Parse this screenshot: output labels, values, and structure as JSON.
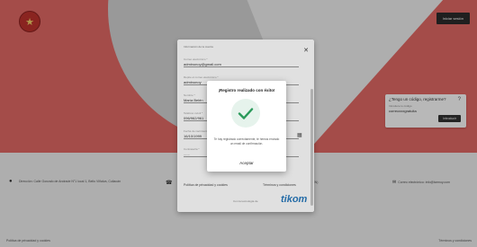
{
  "header": {
    "top_button": "Iniciar sesión"
  },
  "code_card": {
    "title": "¿Tengo un código, registrarme?",
    "input_label": "Introduce tu código",
    "input_value": "correoxxxgratuita",
    "button": "Introducir"
  },
  "footer": {
    "address": "Dirección: Calle Gonzalo de Andrade N°1 local 1, Bello Viñalva, Culiacán",
    "phone_ext": "PEN)",
    "email": "Correo electrónico: info@tarmoy.com",
    "bottom_left": "Política de privacidad y cookies",
    "bottom_right": "Términos y condiciones"
  },
  "registration": {
    "header": "Información de la cuenta",
    "fields": [
      {
        "label": "Correo electrónico *",
        "value": "adminunoy@gmail.com"
      },
      {
        "label": "Repite el correo electrónico *",
        "value": "adminunoy"
      },
      {
        "label": "Nombre *",
        "value": "María Belén"
      },
      {
        "label": "Teléfono móvil *",
        "value": "096/962/961"
      },
      {
        "label": "Fecha de nacimiento *",
        "value": "16/10/1999"
      },
      {
        "label": "Contraseña *",
        "value": "......"
      }
    ],
    "legal": "Política de privacidad y cookies",
    "terms": "Términos y condiciones",
    "tech_label": "Con la tecnología de",
    "brand": "tikom"
  },
  "success_modal": {
    "title": "¡Registro realizado con éxito!",
    "message": "Te hay registrado correctamente, te hemos enviado un email de confirmación.",
    "accept": "Aceptar"
  },
  "colors": {
    "brand_red": "#e46a66",
    "success_green": "#2a9a5a",
    "brand_blue": "#2a7bbf"
  }
}
